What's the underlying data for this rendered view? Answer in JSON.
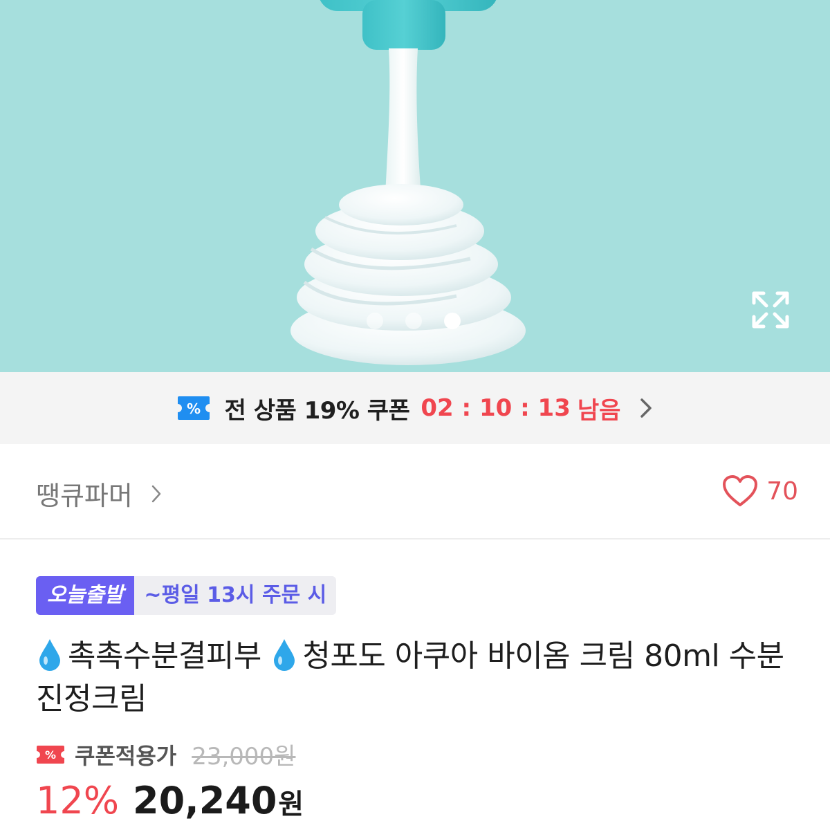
{
  "hero": {
    "image_alt": "product-cream-image",
    "slide_count": 3,
    "active_slide": 3,
    "bg_color": "#a6dfdd"
  },
  "coupon_bar": {
    "text": "전 상품 19% 쿠폰",
    "timer": "02 : 10 : 13",
    "remain": "남음",
    "accent_color": "#f0464f",
    "ticket_color": "#1f8ef1"
  },
  "store": {
    "name": "땡큐파머",
    "likes": "70"
  },
  "product": {
    "badge_today": "오늘출발",
    "badge_time": "~평일 13시 주문 시",
    "title_part1": "촉촉수분결피부",
    "title_part2": "청포도 아쿠아 바이옴 크림 80ml 수분진정크림",
    "coupon_applied_label": "쿠폰적용가",
    "original_price": "23,000원",
    "discount": "12%",
    "sale_price": "20,240",
    "currency": "원"
  }
}
